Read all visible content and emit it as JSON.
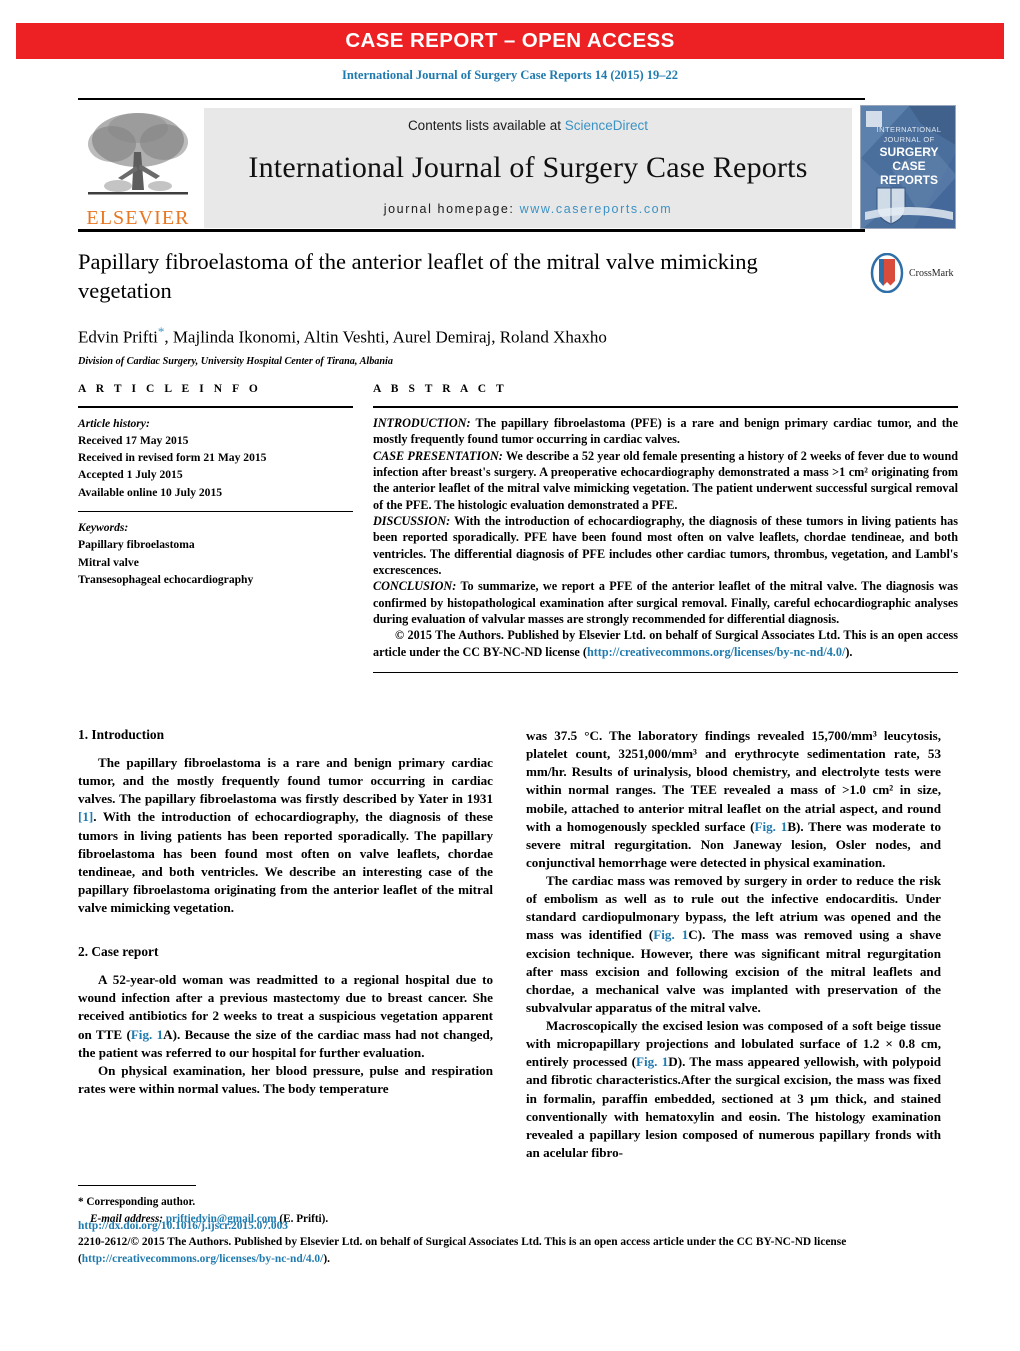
{
  "banner": {
    "text": "CASE REPORT – OPEN ACCESS"
  },
  "citation": {
    "text": "International Journal of Surgery Case Reports 14 (2015) 19–22"
  },
  "masthead": {
    "publisher_logo_name": "ELSEVIER",
    "contents_prefix": "Contents lists available at ",
    "contents_link": "ScienceDirect",
    "journal_title": "International Journal of Surgery Case Reports",
    "homepage_prefix": "journal homepage: ",
    "homepage_link": "www.casereports.com",
    "cover_lines": [
      "INTERNATIONAL",
      "JOURNAL OF",
      "SURGERY",
      "CASE",
      "REPORTS"
    ]
  },
  "article": {
    "title": "Papillary fibroelastoma of the anterior leaflet of the mitral valve mimicking vegetation",
    "authors": "Edvin Prifti",
    "authors_rest": ", Majlinda Ikonomi, Altin Veshti, Aurel Demiraj, Roland Xhaxho",
    "corresponding_marker": "*",
    "affiliation": "Division of Cardiac Surgery, University Hospital Center of Tirana, Albania",
    "crossmark_label": "CrossMark"
  },
  "article_info": {
    "heading": "A R T I C L E   I N F O",
    "history_label": "Article history:",
    "history": [
      "Received 17 May 2015",
      "Received in revised form 21 May 2015",
      "Accepted 1 July 2015",
      "Available online 10 July 2015"
    ],
    "keywords_label": "Keywords:",
    "keywords": [
      "Papillary fibroelastoma",
      "Mitral valve",
      "Transesophageal echocardiography"
    ]
  },
  "abstract": {
    "heading": "A B S T R A C T",
    "sections": [
      {
        "label": "INTRODUCTION:",
        "text": " The papillary fibroelastoma (PFE) is a rare and benign primary cardiac tumor, and the mostly frequently found tumor occurring in cardiac valves."
      },
      {
        "label": "CASE PRESENTATION:",
        "text": " We describe a 52 year old female presenting a history of 2 weeks of fever due to wound infection after breast's surgery. A preoperative echocardiography demonstrated a mass >1 cm² originating from the anterior leaflet of the mitral valve mimicking vegetation. The patient underwent successful surgical removal of the PFE. The histologic evaluation demonstrated a PFE."
      },
      {
        "label": "DISCUSSION:",
        "text": " With the introduction of echocardiography, the diagnosis of these tumors in living patients has been reported sporadically. PFE have been found most often on valve leaflets, chordae tendineae, and both ventricles. The differential diagnosis of PFE includes other cardiac tumors, thrombus, vegetation, and Lambl's excrescences."
      },
      {
        "label": "CONCLUSION:",
        "text": " To summarize, we report a PFE of the anterior leaflet of the mitral valve. The diagnosis was confirmed by histopathological examination after surgical removal. Finally, careful echocardiographic analyses during evaluation of valvular masses are strongly recommended for differential diagnosis."
      }
    ],
    "copyright_pre": "© 2015 The Authors. Published by Elsevier Ltd. on behalf of Surgical Associates Ltd. This is an open access article under the CC BY-NC-ND license (",
    "copyright_link": "http://creativecommons.org/licenses/by-nc-nd/4.0/",
    "copyright_post": ")."
  },
  "body": {
    "left": {
      "h1": "1.  Introduction",
      "p1_a": "The papillary fibroelastoma is a rare and benign primary cardiac tumor, and the mostly frequently found tumor occurring in cardiac valves. The papillary fibroelastoma was firstly described by Yater in 1931 ",
      "p1_ref": "[1]",
      "p1_b": ". With the introduction of echocardiography, the diagnosis of these tumors in living patients has been reported sporadically. The papillary fibroelastoma has been found most often on valve leaflets, chordae tendineae, and both ventricles. We describe an interesting case of the papillary fibroelastoma originating from the anterior leaflet of the mitral valve mimicking vegetation.",
      "h2": "2.  Case report",
      "p2_a": "A 52-year-old woman was readmitted to a regional hospital due to wound infection after a previous mastectomy due to breast cancer. She received antibiotics for 2 weeks to treat a suspicious vegetation apparent on TTE (",
      "p2_fig": "Fig. 1",
      "p2_b": "A). Because the size of the cardiac mass had not changed, the patient was referred to our hospital for further evaluation.",
      "p3": "On physical examination, her blood pressure, pulse and respiration rates were within normal values. The body temperature"
    },
    "right": {
      "p1": "was 37.5 °C. The laboratory findings revealed 15,700/mm³ leucytosis, platelet count, 3251,000/mm³ and erythrocyte sedimentation rate, 53 mm/hr. Results of urinalysis, blood chemistry, and electrolyte tests were within normal ranges. The TEE revealed a mass of >1.0 cm² in size, mobile, attached to anterior mitral leaflet on the atrial aspect, and round with a homogenously speckled surface (",
      "p1_fig": "Fig. 1",
      "p1_b": "B). There was moderate to severe mitral regurgitation. Non Janeway lesion, Osler nodes, and conjunctival hemorrhage were detected in physical examination.",
      "p2_a": "The cardiac mass was removed by surgery in order to reduce the risk of embolism as well as to rule out the infective endocarditis. Under standard cardiopulmonary bypass, the left atrium was opened and the mass was identified (",
      "p2_fig": "Fig. 1",
      "p2_b": "C). The mass was removed using a shave excision technique. However, there was significant mitral regurgitation after mass excision and following excision of the mitral leaflets and chordae, a mechanical valve was implanted with preservation of the subvalvular apparatus of the mitral valve.",
      "p3_a": "Macroscopically the excised lesion was composed of a soft beige tissue with micropapillary projections and lobulated surface of 1.2 × 0.8 cm, entirely processed (",
      "p3_fig": "Fig. 1",
      "p3_b": "D). The mass appeared yellowish, with polypoid and fibrotic characteristics.After the surgical excision, the mass was fixed in formalin, paraffin embedded, sectioned at 3 μm thick, and stained conventionally with hematoxylin and eosin. The histology examination revealed a papillary lesion composed of numerous papillary fronds with an acelular fibro-"
    }
  },
  "footnote": {
    "corresponding": "*  Corresponding author.",
    "email_label": "E-mail address:",
    "email": "priftiedvin@gmail.com",
    "email_owner": " (E. Prifti)."
  },
  "page_footer": {
    "doi": "http://dx.doi.org/10.1016/j.ijscr.2015.07.003",
    "license_pre": "2210-2612/© 2015 The Authors. Published by Elsevier Ltd. on behalf of Surgical Associates Ltd. This is an open access article under the CC BY-NC-ND license (",
    "license_link": "http://creativecommons.org/licenses/by-nc-nd/4.0/",
    "license_post": ")."
  },
  "colors": {
    "banner_red": "#ED2024",
    "link_blue": "#1F7BAF",
    "elsevier_orange": "#E87722",
    "sciencedirect_blue": "#3C92C4"
  }
}
